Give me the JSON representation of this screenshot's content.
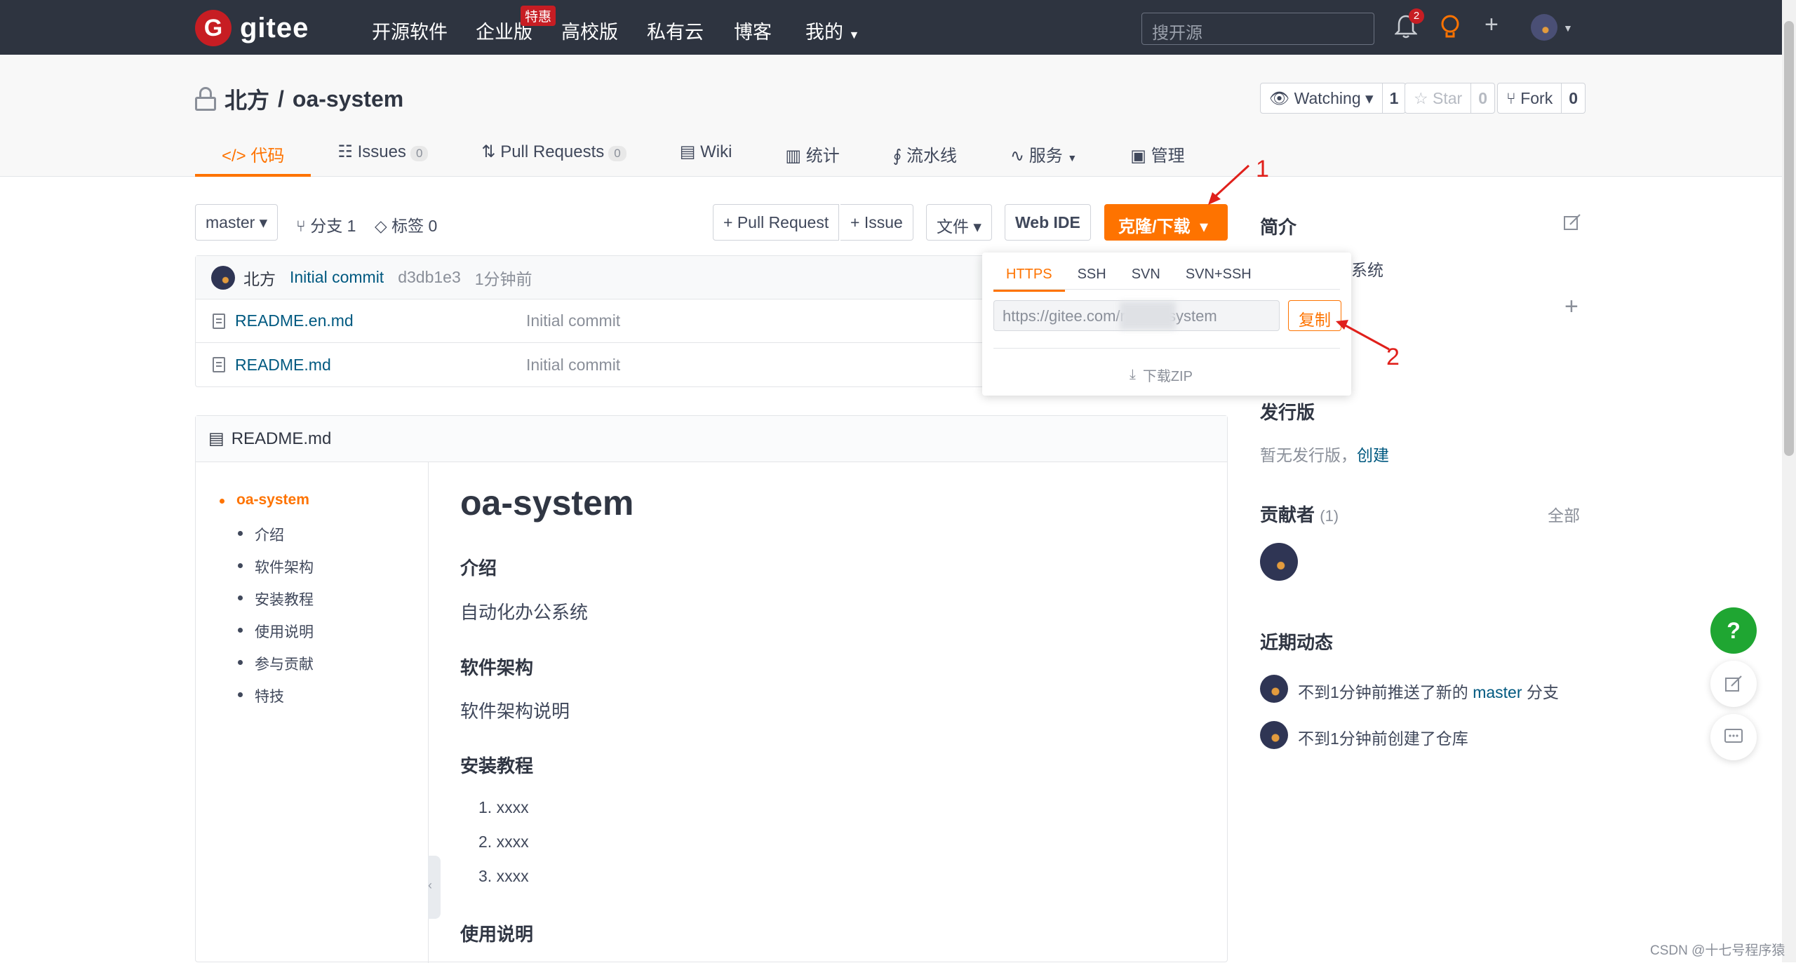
{
  "topbar": {
    "logo_text": "gitee",
    "logo_mark": "G",
    "nav": [
      "开源软件",
      "企业版",
      "高校版",
      "私有云",
      "博客",
      "我的"
    ],
    "hot_badge": "特惠",
    "search_placeholder": "搜开源",
    "notification_count": "2"
  },
  "repo": {
    "owner": "北方",
    "separator": "/",
    "name": "oa-system",
    "watching_label": "Watching",
    "watching_count": "1",
    "star_label": "Star",
    "star_count": "0",
    "fork_label": "Fork",
    "fork_count": "0"
  },
  "tabs": [
    {
      "label": "代码",
      "icon": "code-icon",
      "count": null,
      "active": true
    },
    {
      "label": "Issues",
      "icon": "issues-icon",
      "count": "0"
    },
    {
      "label": "Pull Requests",
      "icon": "pull-request-icon",
      "count": "0"
    },
    {
      "label": "Wiki",
      "icon": "book-icon",
      "count": null
    },
    {
      "label": "统计",
      "icon": "bar-chart-icon",
      "count": null
    },
    {
      "label": "流水线",
      "icon": "pipeline-icon",
      "count": null
    },
    {
      "label": "服务",
      "icon": "pulse-icon",
      "count": null
    },
    {
      "label": "管理",
      "icon": "settings-doc-icon",
      "count": null
    }
  ],
  "toolbar": {
    "branch": "master",
    "branches_label": "分支 1",
    "tags_label": "标签 0",
    "pull_request": "+ Pull Request",
    "issue": "+ Issue",
    "file": "文件",
    "web_ide": "Web IDE",
    "clone": "克隆/下载"
  },
  "commit": {
    "author": "北方",
    "message": "Initial commit",
    "hash": "d3db1e3",
    "time": "1分钟前"
  },
  "files": [
    {
      "name": "README.en.md",
      "message": "Initial commit"
    },
    {
      "name": "README.md",
      "message": "Initial commit"
    }
  ],
  "clone_dropdown": {
    "tabs": [
      "HTTPS",
      "SSH",
      "SVN",
      "SVN+SSH"
    ],
    "active_tab": "HTTPS",
    "url": "https://gitee.com/r          qi/oa-system",
    "copy": "复制",
    "download_zip": "下载ZIP"
  },
  "annotations": [
    "1",
    "2"
  ],
  "readme": {
    "filename": "README.md",
    "toc": [
      "oa-system",
      "介绍",
      "软件架构",
      "安装教程",
      "使用说明",
      "参与贡献",
      "特技"
    ],
    "title": "oa-system",
    "sections": [
      {
        "heading": "介绍",
        "body": "自动化办公系统"
      },
      {
        "heading": "软件架构",
        "body": "软件架构说明"
      },
      {
        "heading": "安装教程",
        "list": [
          "1. xxxx",
          "2. xxxx",
          "3. xxxx"
        ]
      },
      {
        "heading": "使用说明"
      }
    ]
  },
  "sidebar": {
    "intro_title": "简介",
    "intro_text": "系统",
    "releases_title": "发行版",
    "releases_text": "暂无发行版，",
    "releases_create": "创建",
    "contributors_title": "贡献者",
    "contributors_count": "(1)",
    "contributors_all": "全部",
    "activity_title": "近期动态",
    "activity": [
      {
        "prefix": "不到1分钟前推送了新的",
        "link": "master",
        "suffix": "分支"
      },
      {
        "prefix": "不到1分钟前创建了仓库",
        "link": "",
        "suffix": ""
      }
    ]
  },
  "floating": {
    "help": "?"
  },
  "watermark": "CSDN @十七号程序猿",
  "colors": {
    "accent": "#fe7300",
    "brand_red": "#c71d23",
    "link": "#005980",
    "help_green": "#1fa632"
  }
}
